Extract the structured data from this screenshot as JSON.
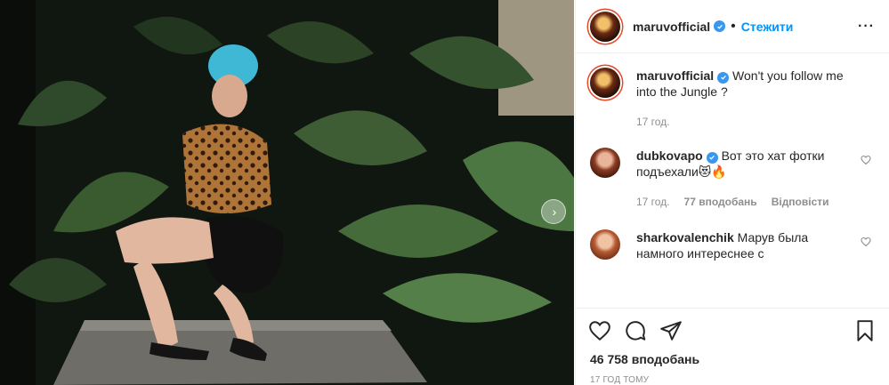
{
  "post": {
    "username": "maruvofficial",
    "follow_label": "Стежити",
    "separator": "•",
    "more_label": "···",
    "next_label": "›"
  },
  "caption": {
    "username": "maruvofficial",
    "text": "Won't you follow me into the Jungle ?",
    "time": "17 год."
  },
  "comments": [
    {
      "username": "dubkovapo",
      "text": "Вот это хат фотки подъехали😻🔥",
      "time": "17 год.",
      "likes": "77 вподобань",
      "reply": "Відповісти"
    },
    {
      "username": "sharkovalenchik",
      "text": "Марув была намного интереснее с"
    }
  ],
  "footer": {
    "likes": "46 758 вподобань",
    "time": "17 ГОД ТОМУ"
  },
  "colors": {
    "accent": "#0095f6",
    "verified": "#3897f0",
    "muted": "#8e8e8e"
  }
}
